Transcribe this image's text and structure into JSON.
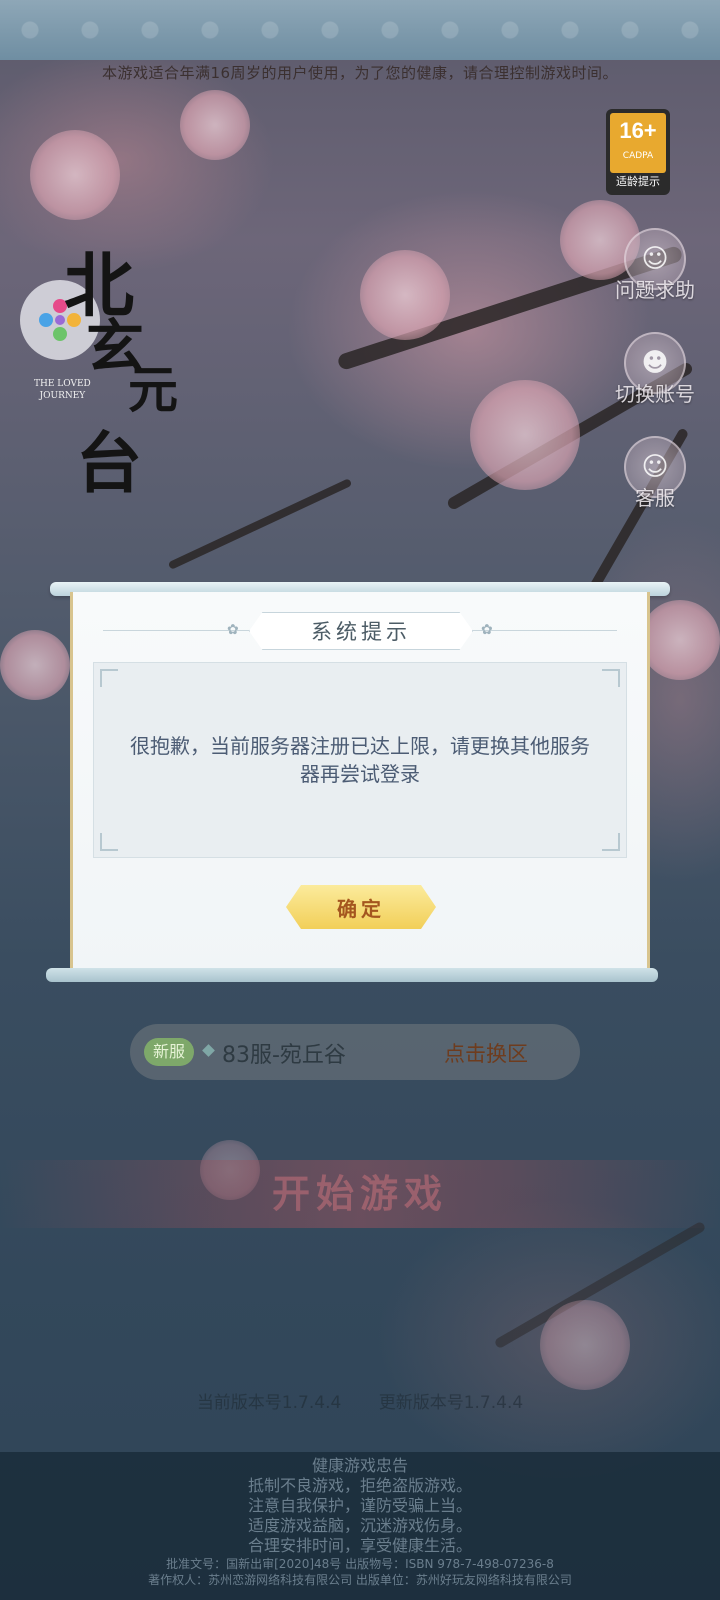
{
  "top_notice": "本游戏适合年满16周岁的用户使用，为了您的健康，请合理控制游戏时间。",
  "age_badge": {
    "number": "16+",
    "org": "CADPA",
    "caption": "适龄提示"
  },
  "side_buttons": [
    {
      "label": "问题求助",
      "icon": "help-icon"
    },
    {
      "label": "切换账号",
      "icon": "switch-account-icon"
    },
    {
      "label": "客服",
      "icon": "customer-service-icon"
    }
  ],
  "logo": {
    "chars": [
      "北",
      "玄",
      "元",
      "台"
    ],
    "en": "THE LOVED\nJOURNEY"
  },
  "dialog": {
    "title": "系统提示",
    "message": "很抱歉，当前服务器注册已达上限，请更换其他服务器再尝试登录",
    "confirm_label": "确定"
  },
  "server": {
    "tag": "新服",
    "name": "83服-宛丘谷",
    "switch_label": "点击换区"
  },
  "start_label": "开始游戏",
  "version": {
    "current": "当前版本号1.7.4.4",
    "latest": "更新版本号1.7.4.4"
  },
  "footer": {
    "title": "健康游戏忠告",
    "lines": [
      "抵制不良游戏，拒绝盗版游戏。",
      "注意自我保护，谨防受骗上当。",
      "适度游戏益脑，沉迷游戏伤身。",
      "合理安排时间，享受健康生活。"
    ],
    "approval": "批准文号：国新出审[2020]48号 出版物号：ISBN 978-7-498-07236-8",
    "copyright": "著作权人：苏州恋游网络科技有限公司 出版单位：苏州好玩友网络科技有限公司"
  },
  "colors": {
    "accent_gold": "#f2cf59",
    "dialog_text": "#4c5c74",
    "new_tag": "#7ea86a"
  }
}
